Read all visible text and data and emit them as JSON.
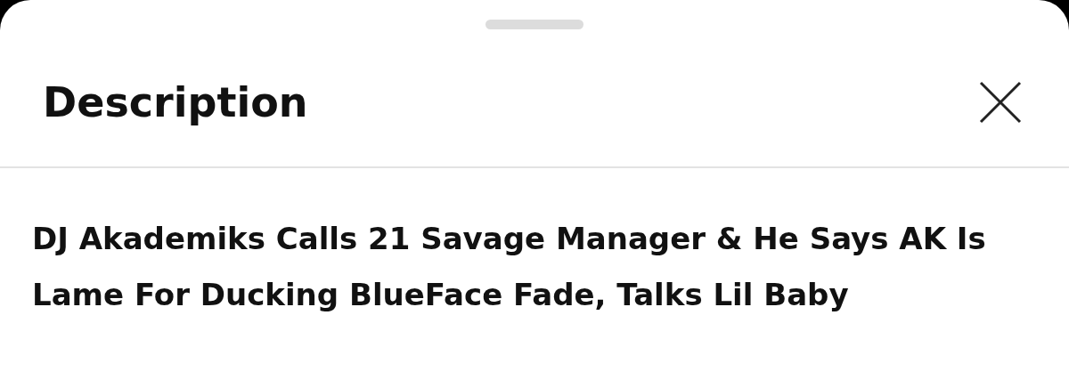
{
  "sheet": {
    "title": "Description",
    "description_title": "DJ Akademiks Calls 21 Savage Manager & He Says AK Is Lame For Ducking BlueFace Fade, Talks Lil Baby"
  }
}
